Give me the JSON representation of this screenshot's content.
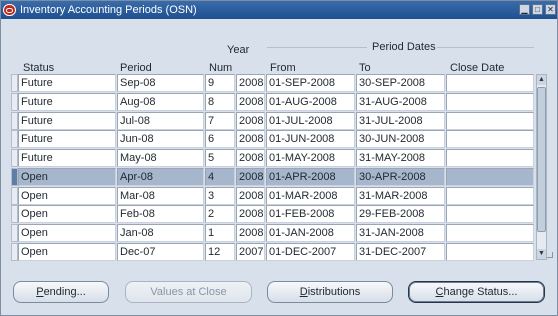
{
  "window": {
    "title": "Inventory Accounting Periods (OSN)",
    "title_icon": "oracle-icon",
    "controls": [
      "minimize-icon",
      "maximize-icon",
      "close-icon"
    ]
  },
  "table": {
    "headers": {
      "status": "Status",
      "period": "Period",
      "year": "Year",
      "num": "Num",
      "period_dates": "Period Dates",
      "from": "From",
      "to": "To",
      "close_date": "Close Date"
    },
    "rows": [
      {
        "status": "Future",
        "period": "Sep-08",
        "num": "9",
        "year": "2008",
        "from": "01-SEP-2008",
        "to": "30-SEP-2008",
        "close_date": ""
      },
      {
        "status": "Future",
        "period": "Aug-08",
        "num": "8",
        "year": "2008",
        "from": "01-AUG-2008",
        "to": "31-AUG-2008",
        "close_date": ""
      },
      {
        "status": "Future",
        "period": "Jul-08",
        "num": "7",
        "year": "2008",
        "from": "01-JUL-2008",
        "to": "31-JUL-2008",
        "close_date": ""
      },
      {
        "status": "Future",
        "period": "Jun-08",
        "num": "6",
        "year": "2008",
        "from": "01-JUN-2008",
        "to": "30-JUN-2008",
        "close_date": ""
      },
      {
        "status": "Future",
        "period": "May-08",
        "num": "5",
        "year": "2008",
        "from": "01-MAY-2008",
        "to": "31-MAY-2008",
        "close_date": ""
      },
      {
        "status": "Open",
        "period": "Apr-08",
        "num": "4",
        "year": "2008",
        "from": "01-APR-2008",
        "to": "30-APR-2008",
        "close_date": "",
        "selected": true
      },
      {
        "status": "Open",
        "period": "Mar-08",
        "num": "3",
        "year": "2008",
        "from": "01-MAR-2008",
        "to": "31-MAR-2008",
        "close_date": ""
      },
      {
        "status": "Open",
        "period": "Feb-08",
        "num": "2",
        "year": "2008",
        "from": "01-FEB-2008",
        "to": "29-FEB-2008",
        "close_date": ""
      },
      {
        "status": "Open",
        "period": "Jan-08",
        "num": "1",
        "year": "2008",
        "from": "01-JAN-2008",
        "to": "31-JAN-2008",
        "close_date": ""
      },
      {
        "status": "Open",
        "period": "Dec-07",
        "num": "12",
        "year": "2007",
        "from": "01-DEC-2007",
        "to": "31-DEC-2007",
        "close_date": ""
      }
    ]
  },
  "buttons": {
    "pending_pre": "P",
    "pending_rest": "ending...",
    "values_at_close": "Values at Close",
    "distributions_pre": "D",
    "distributions_rest": "istributions",
    "change_status_pre": "C",
    "change_status_rest": "hange Status..."
  },
  "colors": {
    "titlebar": "#1e4f8e",
    "selected_row": "#a6b7cd",
    "background": "#d8e0eb"
  }
}
